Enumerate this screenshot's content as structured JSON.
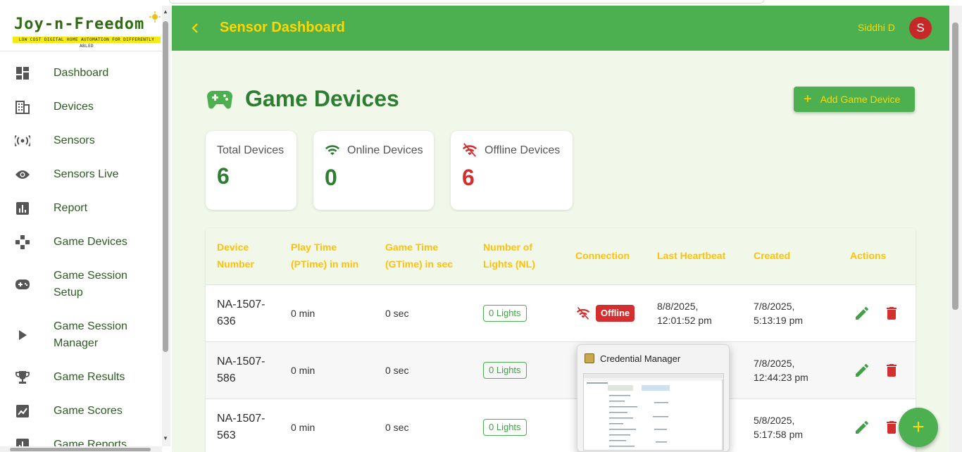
{
  "sidebar": {
    "logo_title": "Joy-n-Freedom",
    "logo_tagline": "LOW COST DIGITAL HOME AUTOMATION FOR DIFFERENTLY ABLED",
    "items": [
      {
        "label": "Dashboard",
        "icon": "dashboard-icon"
      },
      {
        "label": "Devices",
        "icon": "devices-icon"
      },
      {
        "label": "Sensors",
        "icon": "sensors-icon"
      },
      {
        "label": "Sensors Live",
        "icon": "eye-icon"
      },
      {
        "label": "Report",
        "icon": "report-icon"
      },
      {
        "label": "Game Devices",
        "icon": "gamepad-icon"
      },
      {
        "label": "Game Session Setup",
        "icon": "controller-icon"
      },
      {
        "label": "Game Session Manager",
        "icon": "play-icon"
      },
      {
        "label": "Game Results",
        "icon": "trophy-icon"
      },
      {
        "label": "Game Scores",
        "icon": "scores-icon"
      },
      {
        "label": "Game Reports",
        "icon": "report-icon"
      }
    ]
  },
  "appbar": {
    "title": "Sensor Dashboard",
    "user_name": "Siddhi D",
    "avatar_initial": "S"
  },
  "page": {
    "title": "Game Devices",
    "add_button_label": "Add Game Device"
  },
  "stats": {
    "total": {
      "label": "Total Devices",
      "value": "6"
    },
    "online": {
      "label": "Online Devices",
      "value": "0"
    },
    "offline": {
      "label": "Offline Devices",
      "value": "6"
    }
  },
  "table": {
    "headers": {
      "device_number_1": "Device",
      "device_number_2": "Number",
      "play_time_1": "Play Time",
      "play_time_2": "(PTime) in min",
      "game_time_1": "Game Time",
      "game_time_2": "(GTime) in sec",
      "lights_1": "Number of",
      "lights_2": "Lights (NL)",
      "connection": "Connection",
      "last_heartbeat": "Last Heartbeat",
      "created": "Created",
      "actions": "Actions"
    },
    "rows": [
      {
        "device_1": "NA-1507-",
        "device_2": "636",
        "play_time": "0 min",
        "game_time": "0 sec",
        "lights": "0 Lights",
        "connection": "Offline",
        "heartbeat_1": "8/8/2025,",
        "heartbeat_2": "12:01:52 pm",
        "created_1": "7/8/2025,",
        "created_2": "5:13:19 pm"
      },
      {
        "device_1": "NA-1507-",
        "device_2": "586",
        "play_time": "0 min",
        "game_time": "0 sec",
        "lights": "0 Lights",
        "connection": "",
        "heartbeat_1": "",
        "heartbeat_2": "",
        "created_1": "7/8/2025,",
        "created_2": "12:44:23 pm"
      },
      {
        "device_1": "NA-1507-",
        "device_2": "563",
        "play_time": "0 min",
        "game_time": "0 sec",
        "lights": "0 Lights",
        "connection": "",
        "heartbeat_1": "",
        "heartbeat_2": "",
        "created_1": "5/8/2025,",
        "created_2": "5:17:58 pm"
      }
    ]
  },
  "fab_label": "+",
  "preview": {
    "title": "Credential Manager"
  },
  "colors": {
    "primary": "#4caf50",
    "accent": "#ffd600",
    "header_text": "#ffc107",
    "offline": "#d32f2f",
    "dark_green": "#2e7d32",
    "background": "#f1f8e9"
  }
}
